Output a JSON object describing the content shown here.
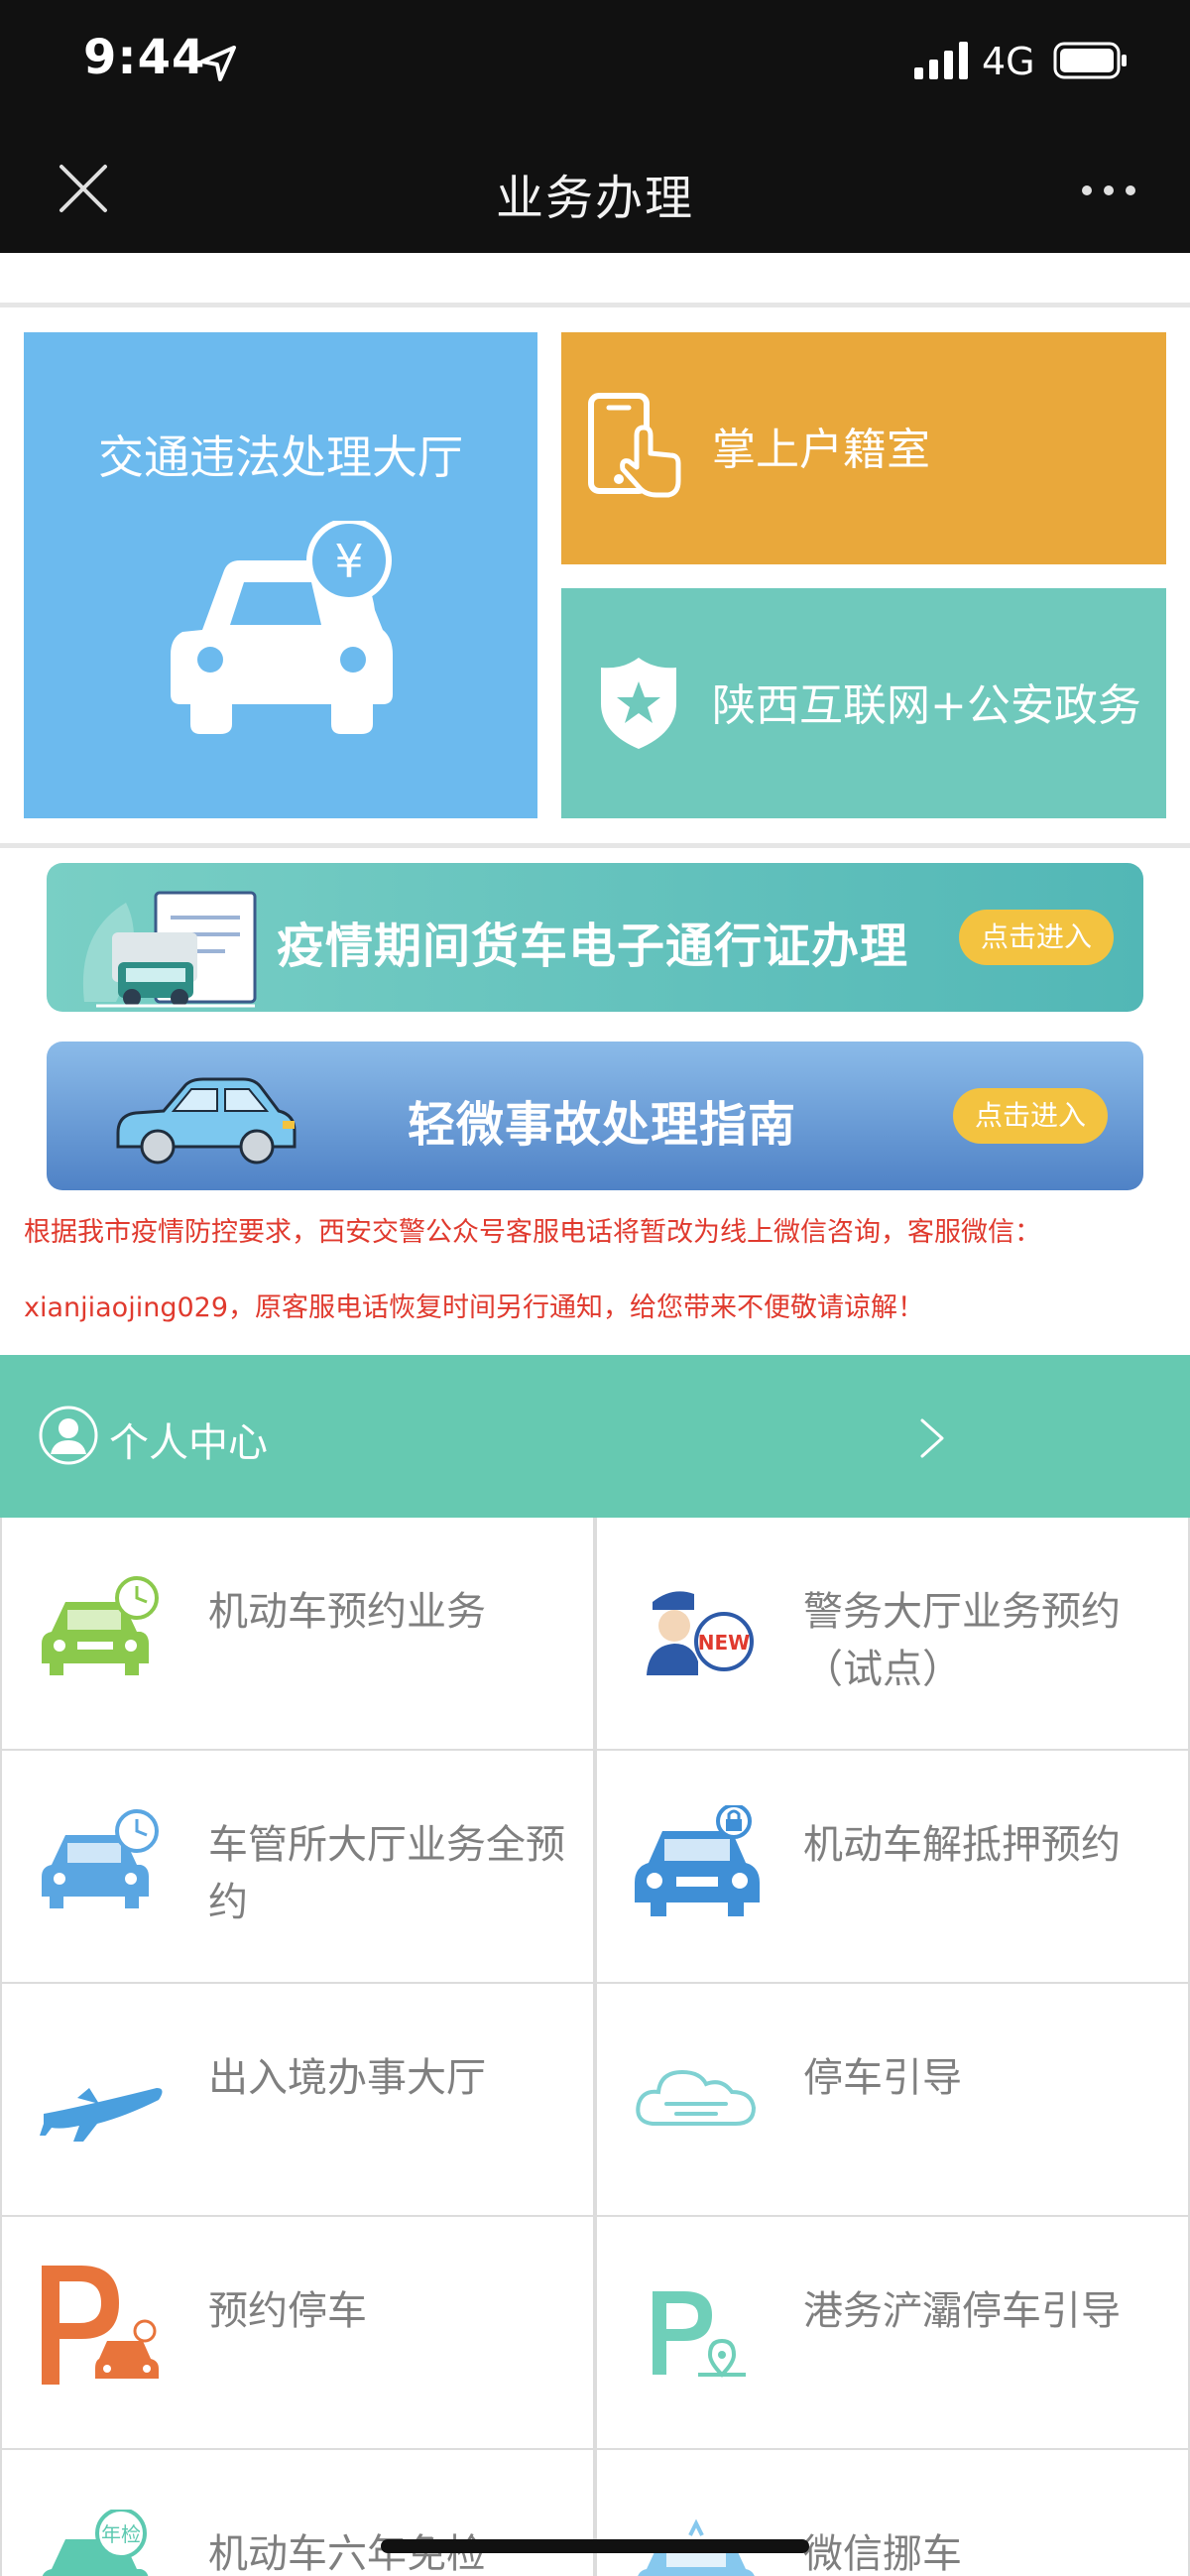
{
  "status_bar": {
    "time": "9:44",
    "network": "4G"
  },
  "title_bar": {
    "title": "业务办理"
  },
  "tiles": {
    "traffic": {
      "label": "交通违法处理大厅",
      "currency_symbol": "¥"
    },
    "household": {
      "label": "掌上户籍室"
    },
    "police": {
      "label": "陕西互联网+公安政务"
    }
  },
  "banners": {
    "covid": {
      "title": "疫情期间货车电子通行证办理",
      "button": "点击进入"
    },
    "accident": {
      "title": "轻微事故处理指南",
      "button": "点击进入"
    }
  },
  "notice": {
    "line1": "根据我市疫情防控要求，西安交警公众号客服电话将暂改为线上微信咨询，客服微信：",
    "line2": "xianjiaojing029，原客服电话恢复时间另行通知，给您带来不便敬请谅解！"
  },
  "personal_center": {
    "label": "个人中心"
  },
  "grid": [
    {
      "label": "机动车预约业务",
      "icon": "car-clock-icon"
    },
    {
      "label": "警务大厅业务预约（试点）",
      "icon": "police-new-icon"
    },
    {
      "label": "车管所大厅业务全预约",
      "icon": "car-clock-icon"
    },
    {
      "label": "机动车解抵押预约",
      "icon": "car-lock-icon"
    },
    {
      "label": "出入境办事大厅",
      "icon": "airplane-icon"
    },
    {
      "label": "停车引导",
      "icon": "parking-guide-icon"
    },
    {
      "label": "预约停车",
      "icon": "parking-reserve-icon"
    },
    {
      "label": "港务浐灞停车引导",
      "icon": "parking-location-icon"
    },
    {
      "label": "机动车六年免检",
      "icon": "annual-inspection-icon",
      "badge": "年检"
    },
    {
      "label": "微信挪车",
      "icon": "move-car-icon"
    }
  ],
  "colors": {
    "traffic_tile": "#6cbaee",
    "household_tile": "#e9a83b",
    "police_tile": "#6fc9bc",
    "personal_center": "#66c9b1",
    "notice_text": "#e03a2e",
    "enter_button": "#f3c340"
  }
}
